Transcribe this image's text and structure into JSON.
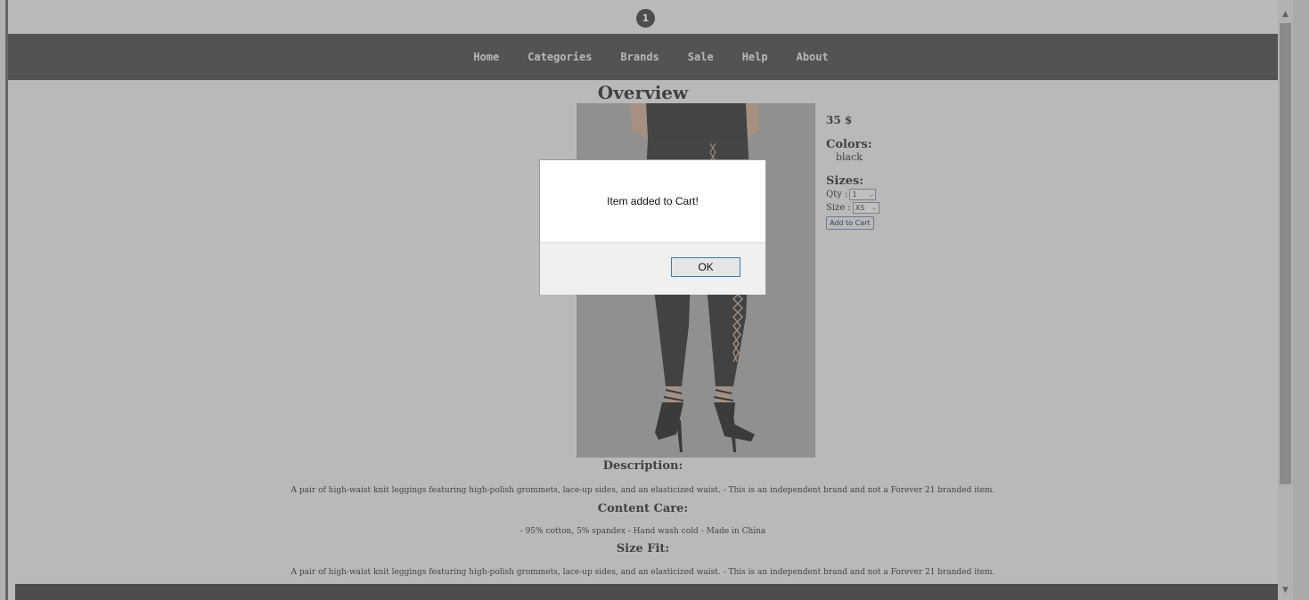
{
  "header": {
    "cart_count": "1"
  },
  "nav": {
    "items": [
      "Home",
      "Categories",
      "Brands",
      "Sale",
      "Help",
      "About"
    ]
  },
  "product": {
    "overview_title": "Overview",
    "price": "35 $",
    "colors_label": "Colors:",
    "color_value": "black",
    "sizes_label": "Sizes:",
    "qty_label": "Qty :",
    "qty_value": "1",
    "size_label": "Size :",
    "size_value": "XS",
    "add_to_cart_label": "Add to Cart"
  },
  "sections": {
    "description_heading": "Description:",
    "description_text": "A pair of high-waist knit leggings featuring high-polish grommets, lace-up sides, and an elasticized waist. - This is an independent brand and not a Forever 21 branded item.",
    "content_care_heading": "Content Care:",
    "content_care_text": "- 95% cotton, 5% spandex - Hand wash cold - Made in China",
    "size_fit_heading": "Size Fit:",
    "size_fit_text": "A pair of high-waist knit leggings featuring high-polish grommets, lace-up sides, and an elasticized waist. - This is an independent brand and not a Forever 21 branded item."
  },
  "dialog": {
    "message": "Item added to Cart!",
    "ok_label": "OK"
  },
  "colors": {
    "navbar": "#3a3a3a",
    "overlay": "#787878",
    "ok_border": "#3c7fb1"
  }
}
